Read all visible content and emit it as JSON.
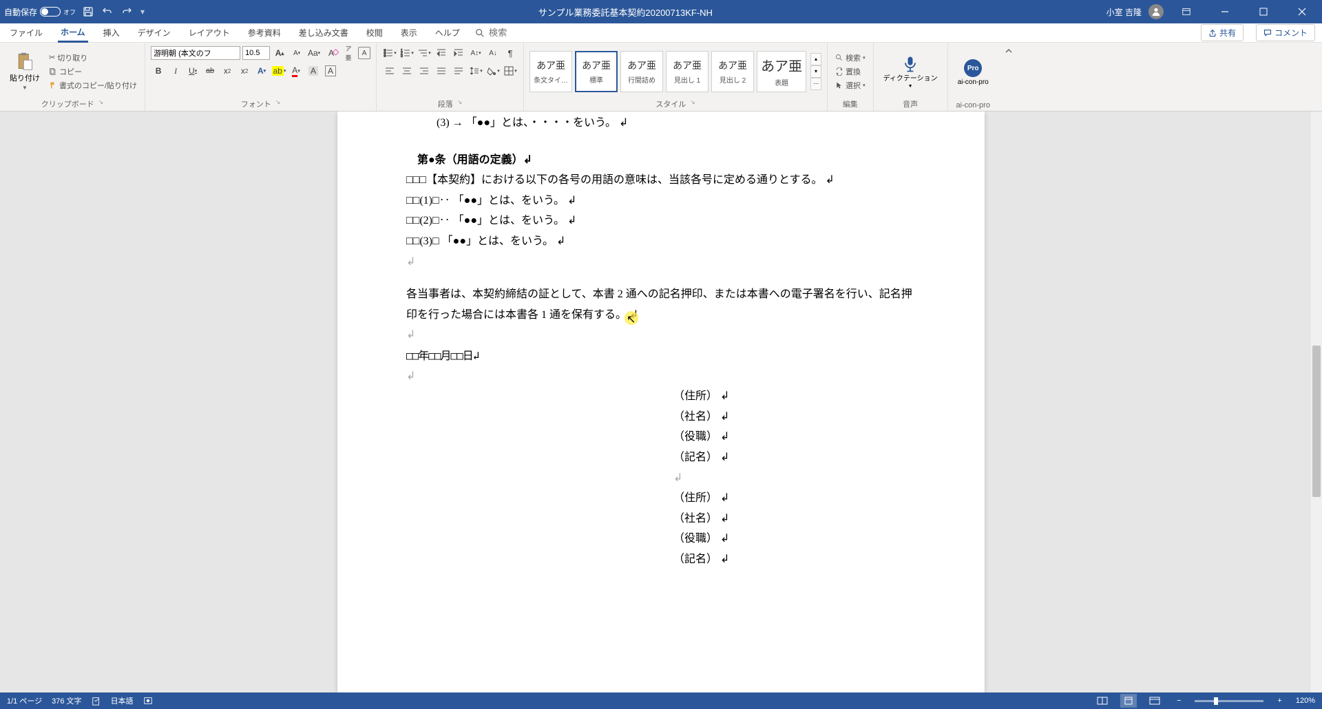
{
  "titlebar": {
    "auto_save_label": "自動保存",
    "auto_save_state": "オフ",
    "doc_title": "サンプル業務委託基本契約20200713KF-NH",
    "user_name": "小室 吉隆"
  },
  "tabs": {
    "file": "ファイル",
    "home": "ホーム",
    "insert": "挿入",
    "design": "デザイン",
    "layout": "レイアウト",
    "references": "参考資料",
    "mailings": "差し込み文書",
    "review": "校閲",
    "view": "表示",
    "help": "ヘルプ",
    "search_placeholder": "検索",
    "share": "共有",
    "comment": "コメント"
  },
  "ribbon": {
    "clipboard": {
      "paste": "貼り付け",
      "cut": "切り取り",
      "copy": "コピー",
      "format_painter": "書式のコピー/貼り付け",
      "group": "クリップボード"
    },
    "font": {
      "name": "游明朝 (本文のフ",
      "size": "10.5",
      "group": "フォント"
    },
    "paragraph": {
      "group": "段落"
    },
    "styles": {
      "preview": "あア亜",
      "preview_large": "あア亜",
      "items": [
        {
          "name": "条文タイ…"
        },
        {
          "name": "標準"
        },
        {
          "name": "行間詰め"
        },
        {
          "name": "見出し 1"
        },
        {
          "name": "見出し 2"
        },
        {
          "name": "表題"
        }
      ],
      "group": "スタイル"
    },
    "editing": {
      "find": "検索",
      "replace": "置換",
      "select": "選択",
      "group": "編集"
    },
    "voice": {
      "dictate": "ディクテーション",
      "group": "音声"
    },
    "addin": {
      "name": "ai-con-pro",
      "group": "ai-con-pro"
    }
  },
  "document": {
    "lines": [
      "(3) → 「●●」とは、・・・・をいう。 ↲",
      "第●条（用語の定義）↲",
      "□□□【本契約】における以下の各号の用語の意味は、当該各号に定める通りとする。 ↲",
      "□□(1)□‥ 「●●」とは、をいう。 ↲",
      "□□(2)□‥ 「●●」とは、をいう。 ↲",
      "□□(3)□ 「●●」とは、をいう。 ↲",
      "↲",
      "各当事者は、本契約締結の証として、本書 2 通への記名押印、または本書への電子署名を行い、記名押印を行った場合には本書各 1 通を保有する。 ↲",
      "↲",
      "□□年□□月□□日↲",
      "↲",
      "（住所） ↲",
      "（社名） ↲",
      "（役職） ↲",
      "（記名） ↲",
      "↲",
      "（住所） ↲",
      "（社名） ↲",
      "（役職） ↲",
      "（記名） ↲"
    ]
  },
  "statusbar": {
    "page": "1/1 ページ",
    "words": "376 文字",
    "lang": "日本語",
    "zoom": "120%"
  }
}
